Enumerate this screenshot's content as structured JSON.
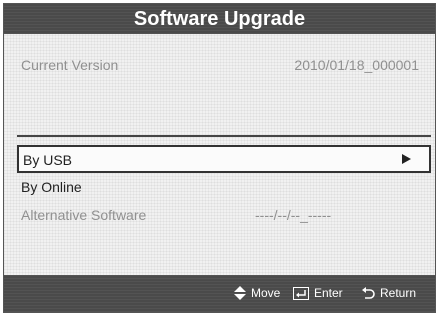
{
  "title": "Software Upgrade",
  "current_version": {
    "label": "Current Version",
    "value": "2010/01/18_000001"
  },
  "menu": {
    "items": [
      {
        "label": "By USB",
        "selected": true,
        "enabled": true
      },
      {
        "label": "By Online",
        "selected": false,
        "enabled": true
      },
      {
        "label": "Alternative Software",
        "value": "----/--/--_-----",
        "selected": false,
        "enabled": false
      }
    ]
  },
  "footer": {
    "move_label": "Move",
    "enter_label": "Enter",
    "return_label": "Return"
  },
  "colors": {
    "bar": "#4a4a4a",
    "muted_text": "#909090",
    "text": "#222222"
  },
  "icons": [
    "right-arrow-icon",
    "up-down-arrow-icon",
    "enter-icon",
    "return-icon"
  ]
}
